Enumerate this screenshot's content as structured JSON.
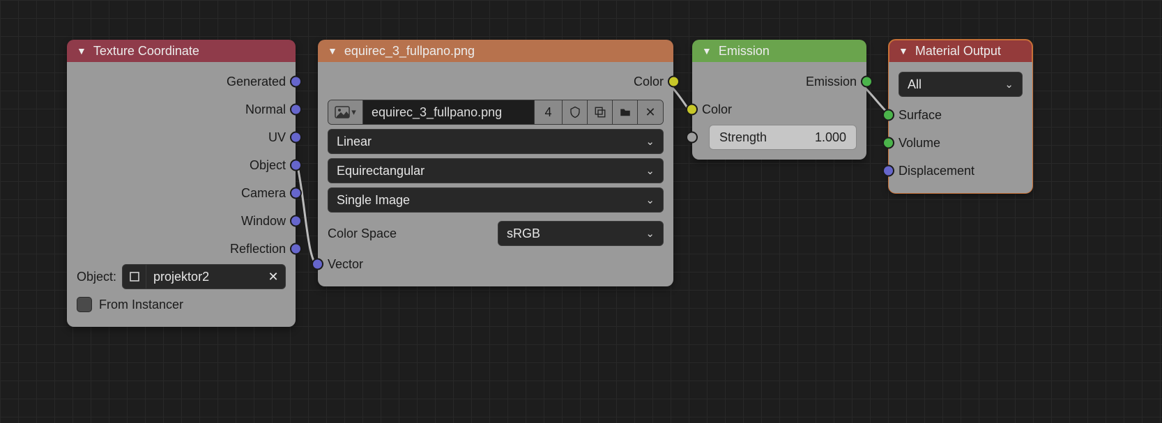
{
  "texcoord": {
    "title": "Texture Coordinate",
    "outputs": [
      "Generated",
      "Normal",
      "UV",
      "Object",
      "Camera",
      "Window",
      "Reflection"
    ],
    "objectLabel": "Object:",
    "objectValue": "projektor2",
    "fromInstancerLabel": "From Instancer"
  },
  "envtex": {
    "title": "equirec_3_fullpano.png",
    "outColor": "Color",
    "filename": "equirec_3_fullpano.png",
    "users": "4",
    "interp": "Linear",
    "projection": "Equirectangular",
    "source": "Single Image",
    "colorSpaceLabel": "Color Space",
    "colorSpaceValue": "sRGB",
    "inVector": "Vector"
  },
  "emission": {
    "title": "Emission",
    "outEmission": "Emission",
    "inColor": "Color",
    "strengthLabel": "Strength",
    "strengthValue": "1.000"
  },
  "matout": {
    "title": "Material Output",
    "target": "All",
    "inSurface": "Surface",
    "inVolume": "Volume",
    "inDisplacement": "Displacement"
  }
}
